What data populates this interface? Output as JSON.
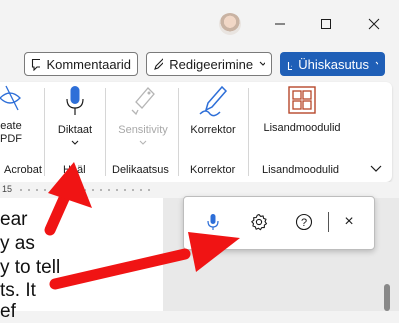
{
  "actionbar": {
    "comments_label": "Kommentaarid",
    "editing_label": "Redigeerimine",
    "share_label": "Ühiskasutus"
  },
  "ribbon": {
    "create_pdf_line1": "eate",
    "create_pdf_line2": "PDF",
    "acrobat_group": "Acrobat",
    "dictate_label": "Diktaat",
    "voice_group": "Hääl",
    "sensitivity_label": "Sensitivity",
    "sensitivity_group": "Delikaatsus",
    "editor_label": "Korrektor",
    "editor_group": "Korrektor",
    "addins_label": "Lisandmoodulid",
    "addins_group": "Lisandmoodulid"
  },
  "ruler": {
    "mark": "15"
  },
  "document": {
    "lines": [
      "ear",
      "y as",
      "y to tell",
      "ts. It",
      "ef"
    ]
  },
  "dictation": {
    "close_glyph": "×",
    "help_glyph": "?"
  },
  "colors": {
    "accent": "#1f5fb7",
    "mic_blue": "#2e6fd8",
    "arrow_red": "#f01414",
    "office_orange": "#b7472a"
  }
}
